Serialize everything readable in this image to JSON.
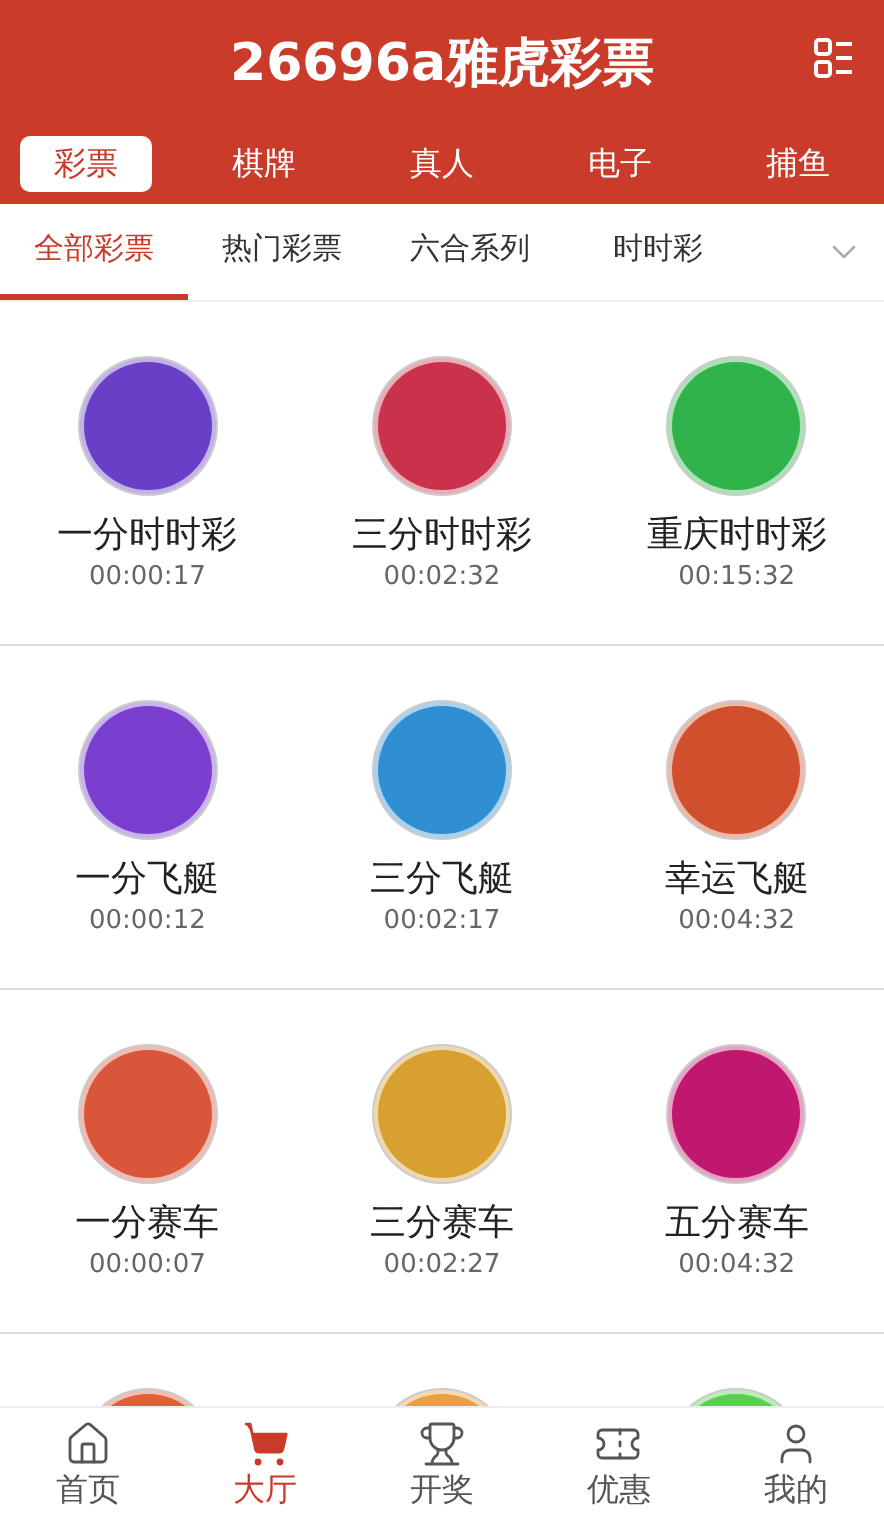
{
  "header": {
    "title": "26696a雅虎彩票"
  },
  "categories": [
    {
      "label": "彩票",
      "selected": true
    },
    {
      "label": "棋牌",
      "selected": false
    },
    {
      "label": "真人",
      "selected": false
    },
    {
      "label": "电子",
      "selected": false
    },
    {
      "label": "捕鱼",
      "selected": false
    }
  ],
  "subtabs": [
    {
      "label": "全部彩票",
      "selected": true
    },
    {
      "label": "热门彩票",
      "selected": false
    },
    {
      "label": "六合系列",
      "selected": false
    },
    {
      "label": "时时彩",
      "selected": false
    }
  ],
  "games": [
    {
      "name": "一分时时彩",
      "countdown": "00:00:17",
      "color": "#6a3fc8"
    },
    {
      "name": "三分时时彩",
      "countdown": "00:02:32",
      "color": "#c9324a"
    },
    {
      "name": "重庆时时彩",
      "countdown": "00:15:32",
      "color": "#2fb34a"
    },
    {
      "name": "一分飞艇",
      "countdown": "00:00:12",
      "color": "#7a3fcf"
    },
    {
      "name": "三分飞艇",
      "countdown": "00:02:17",
      "color": "#2f8fd0"
    },
    {
      "name": "幸运飞艇",
      "countdown": "00:04:32",
      "color": "#d0502e"
    },
    {
      "name": "一分赛车",
      "countdown": "00:00:07",
      "color": "#d9563a"
    },
    {
      "name": "三分赛车",
      "countdown": "00:02:27",
      "color": "#d8a030"
    },
    {
      "name": "五分赛车",
      "countdown": "00:04:32",
      "color": "#c0186e"
    },
    {
      "color": "#e0603a"
    },
    {
      "color": "#e8a040"
    },
    {
      "color": "#5ad050"
    }
  ],
  "nav": [
    {
      "label": "首页",
      "selected": false
    },
    {
      "label": "大厅",
      "selected": true
    },
    {
      "label": "开奖",
      "selected": false
    },
    {
      "label": "优惠",
      "selected": false
    },
    {
      "label": "我的",
      "selected": false
    }
  ]
}
